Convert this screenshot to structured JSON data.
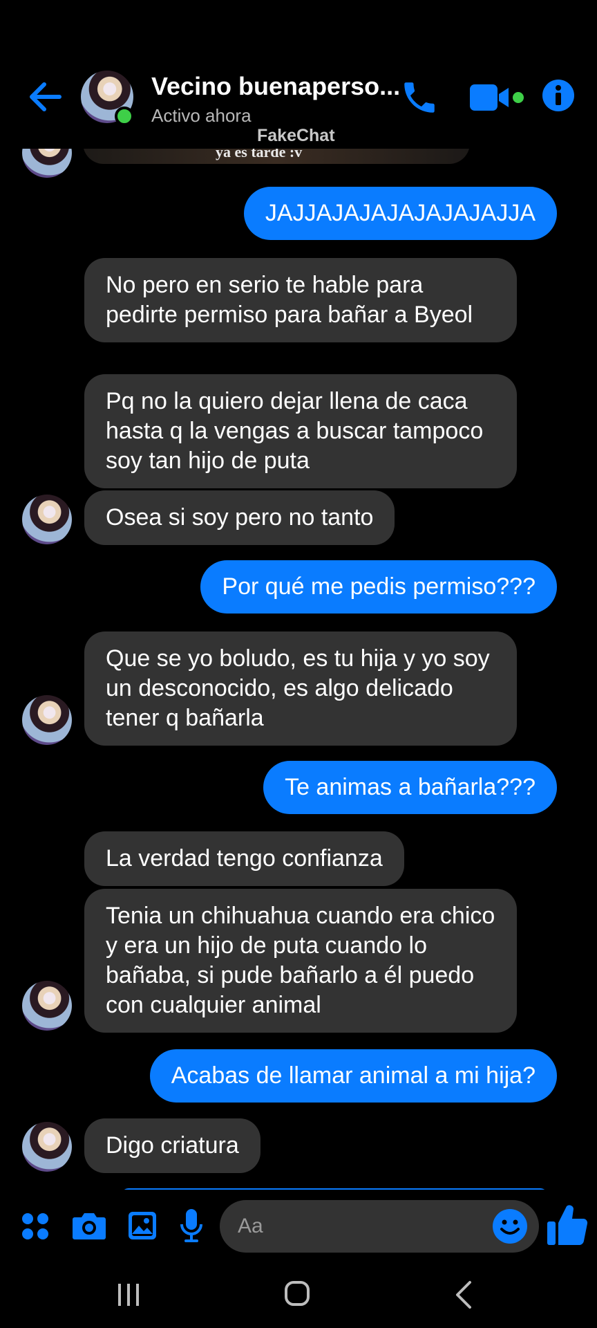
{
  "header": {
    "contact_name": "Vecino buenaperso...",
    "status": "Activo ahora",
    "watermark": "FakeChat"
  },
  "colors": {
    "accent": "#0a7cff",
    "received_bubble": "#333333",
    "online": "#3ecf48",
    "background": "#000000"
  },
  "icons": [
    "back-arrow-icon",
    "phone-icon",
    "video-camera-icon",
    "info-icon",
    "apps-icon",
    "camera-icon",
    "image-icon",
    "microphone-icon",
    "emoji-icon",
    "thumbs-up-icon",
    "recents-icon",
    "home-icon",
    "back-nav-icon"
  ],
  "chat": {
    "prev_message_text": "ya es tarde :v",
    "messages": [
      {
        "side": "sent",
        "text": "JAJJAJAJAJAJAJAJAJJA"
      },
      {
        "side": "received",
        "text": "No pero en serio te hable para pedirte permiso para bañar a Byeol"
      },
      {
        "side": "received",
        "text": "Pq no la quiero dejar llena de caca hasta q la vengas a buscar tampoco soy tan hijo de puta"
      },
      {
        "side": "received",
        "text": "Osea si soy pero no tanto"
      },
      {
        "side": "sent",
        "text": "Por qué me pedis permiso???"
      },
      {
        "side": "received",
        "text": "Que se yo boludo, es tu hija y yo soy un desconocido, es algo delicado tener q bañarla"
      },
      {
        "side": "sent",
        "text": "Te animas a bañarla???"
      },
      {
        "side": "received",
        "text": "La verdad tengo confianza"
      },
      {
        "side": "received",
        "text": "Tenia un chihuahua cuando era chico y era un hijo de puta cuando lo bañaba, si pude bañarlo a él puedo con cualquier animal"
      },
      {
        "side": "sent",
        "text": "Acabas de llamar animal a mi hija?"
      },
      {
        "side": "received",
        "text": "Digo criatura"
      }
    ]
  },
  "composer": {
    "placeholder": "Aa"
  }
}
